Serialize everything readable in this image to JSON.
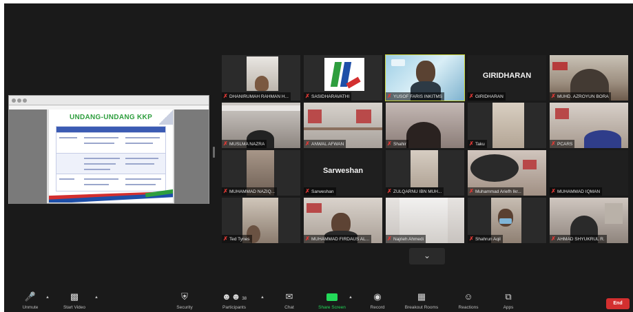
{
  "shared_slide": {
    "title": "UNDANG-UNDANG KKP"
  },
  "gallery": {
    "tiles": [
      {
        "name": "DHANIRUMAH RAHMAN H..."
      },
      {
        "name": "SASIDHARAVATHI"
      },
      {
        "name": "YUSOF FARIS INKITMS"
      },
      {
        "name": "GIRIDHARAN",
        "label": "GIRIDHARAN"
      },
      {
        "name": "MUHD. AZROYUN BORA"
      },
      {
        "name": "MUSLMA NAZRA"
      },
      {
        "name": "ANWAL AFWAN"
      },
      {
        "name": "Shahir"
      },
      {
        "name": "Taku"
      },
      {
        "name": "PCARS"
      },
      {
        "name": "MUHAMMAD NAZIQ..."
      },
      {
        "name": "Sarweshan",
        "label": "Sarweshan"
      },
      {
        "name": "ZULQARNU IBN MUH..."
      },
      {
        "name": "Muhammad Ariefh Ikr..."
      },
      {
        "name": "MUHAMMAD IQMAN"
      },
      {
        "name": "Ted Tynes"
      },
      {
        "name": "MUHAMMAD FIRDAUS AL..."
      },
      {
        "name": "Najrieh Ahmedi"
      },
      {
        "name": "Shahrun Aqil"
      },
      {
        "name": "AHMAD SHYUKRUL R."
      }
    ]
  },
  "toolbar": {
    "unmute": "Unmute",
    "start_video": "Start Video",
    "security": "Security",
    "participants": "Participants",
    "participants_count": "38",
    "chat": "Chat",
    "share_screen": "Share Screen",
    "record": "Record",
    "breakout_rooms": "Breakout Rooms",
    "reactions": "Reactions",
    "apps": "Apps",
    "end": "End"
  },
  "colors": {
    "background": "#1a1a1a",
    "active_speaker_border": "#c9d33a",
    "muted_icon": "#e53935",
    "share_green": "#23d959",
    "end_red": "#d32f2f"
  }
}
